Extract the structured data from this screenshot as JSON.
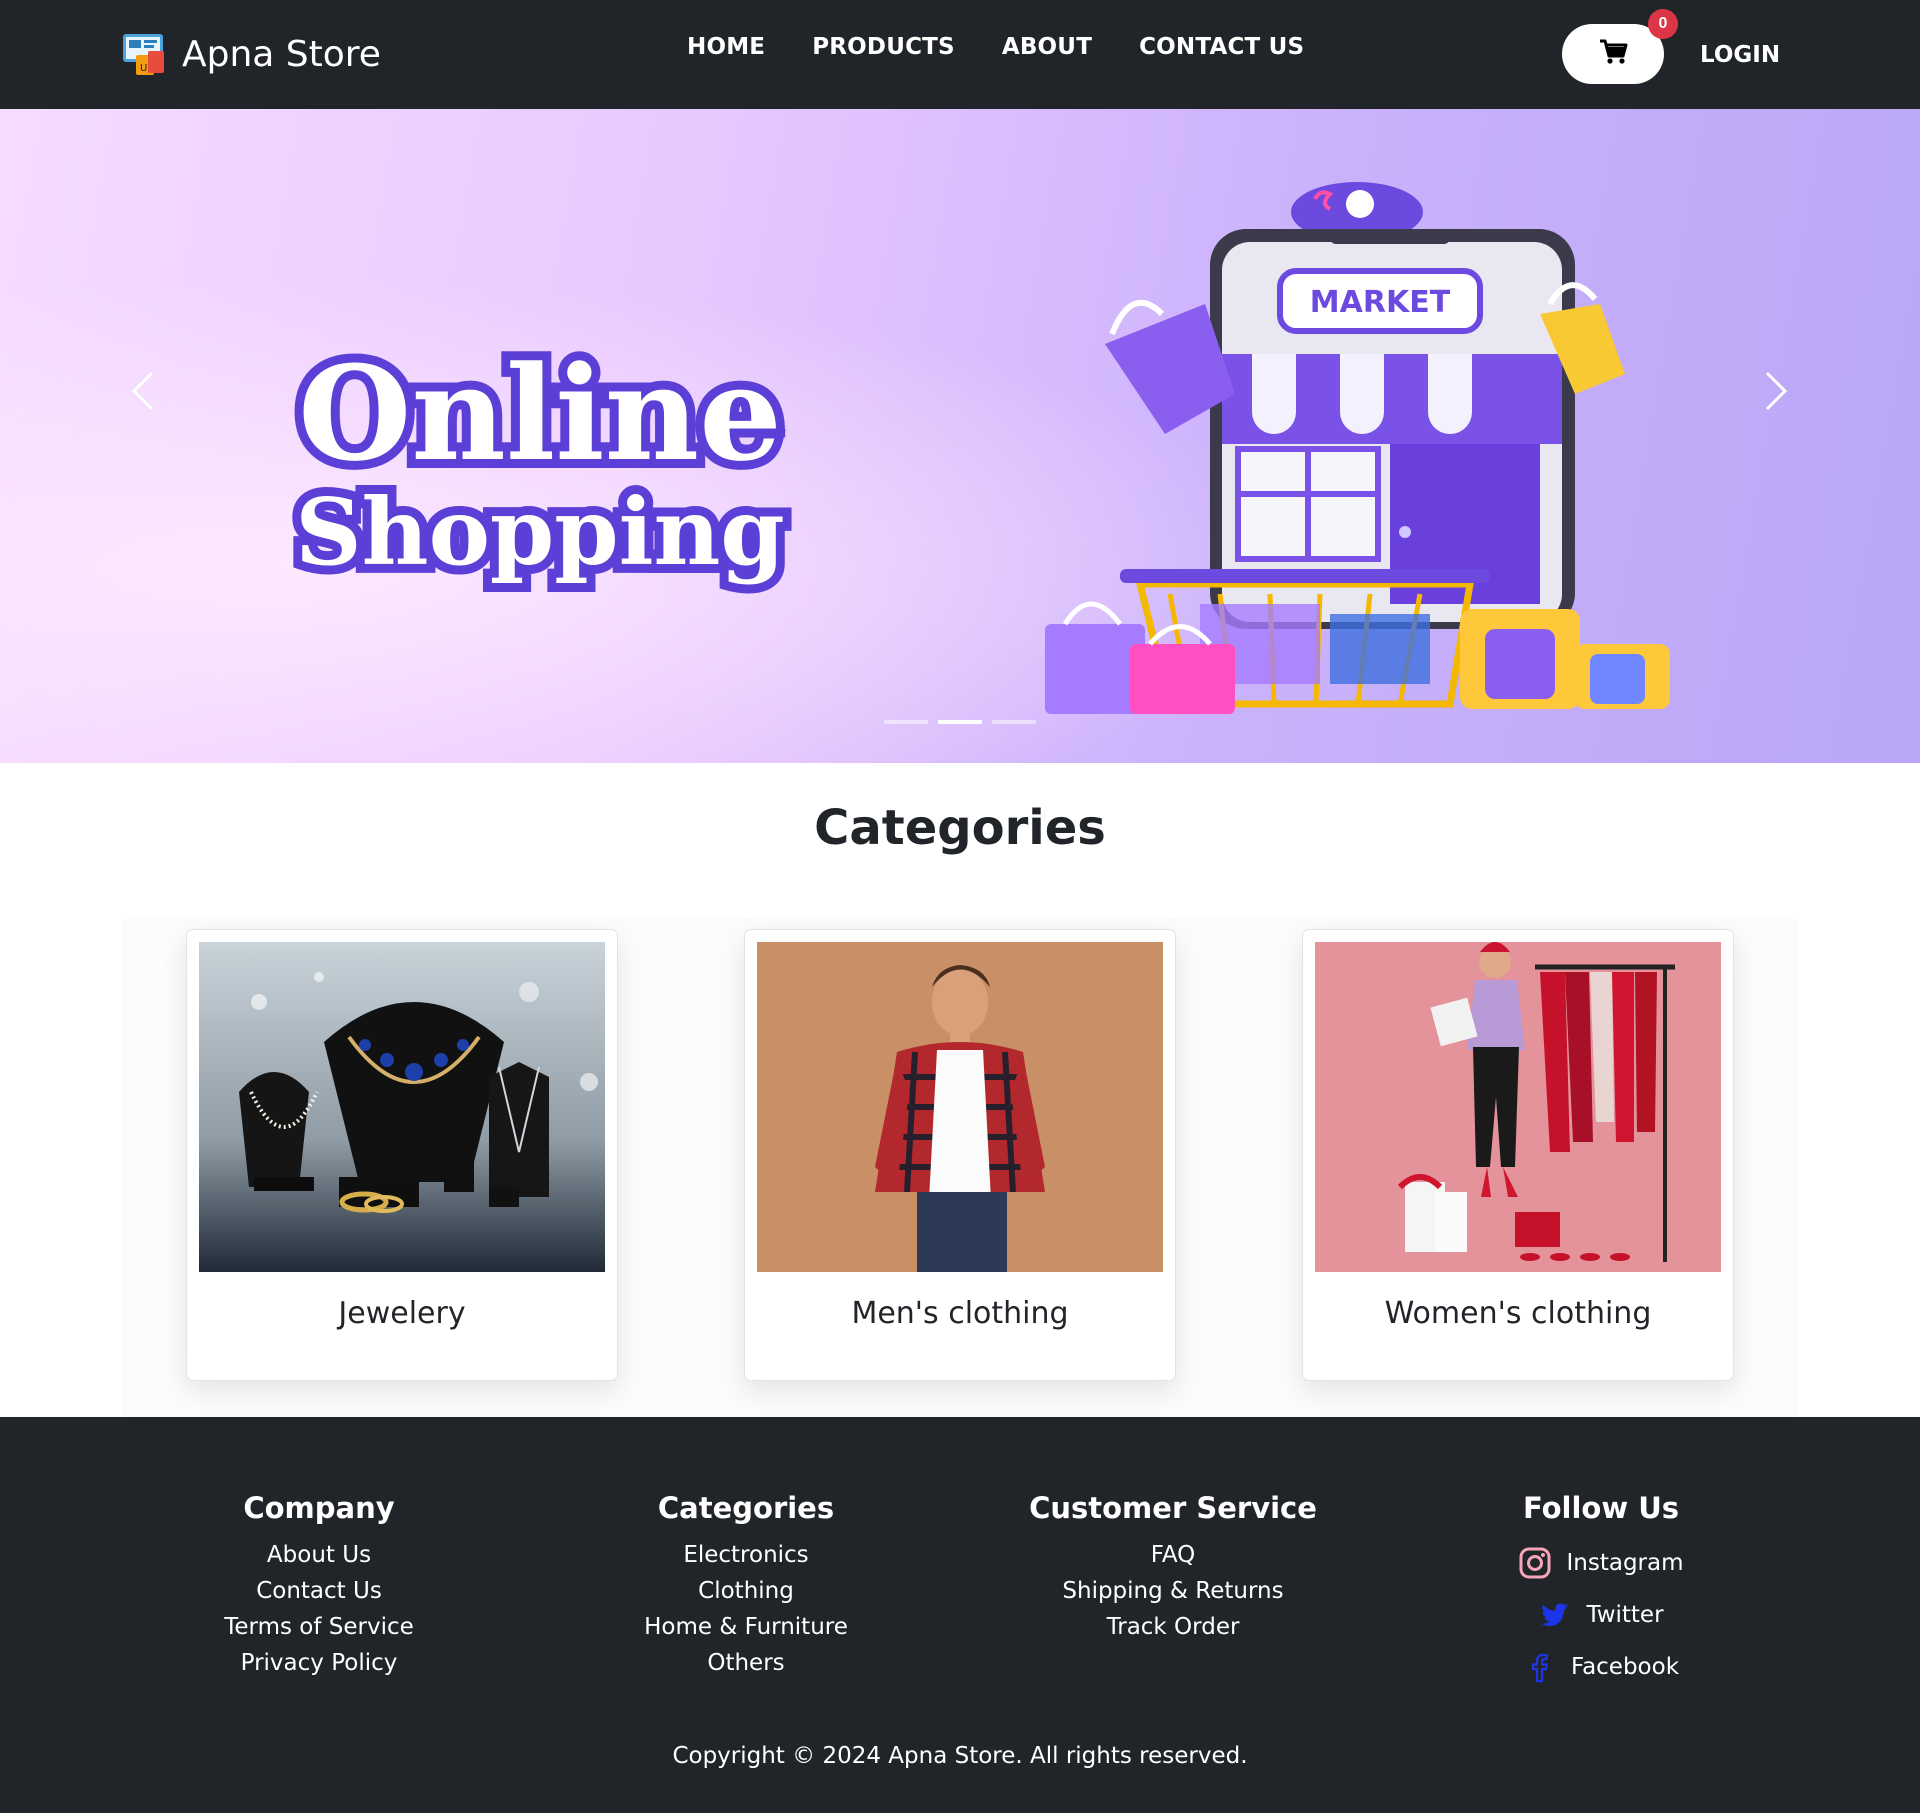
{
  "brand": {
    "name": "Apna Store",
    "logo_icon": "store-logo-icon"
  },
  "nav": {
    "items": [
      "HOME",
      "PRODUCTS",
      "ABOUT",
      "CONTACT US"
    ],
    "cart_count": "0",
    "login": "LOGIN"
  },
  "hero": {
    "title_line1": "Online",
    "title_line2": "Shopping",
    "sign_text": "MARKET",
    "slides": 3,
    "active_slide": 2,
    "accent_color": "#5b3fd6"
  },
  "categories": {
    "heading": "Categories",
    "items": [
      {
        "label": "Jewelery"
      },
      {
        "label": "Men's clothing"
      },
      {
        "label": "Women's clothing"
      }
    ]
  },
  "footer": {
    "company": {
      "title": "Company",
      "links": [
        "About Us",
        "Contact Us",
        "Terms of Service",
        "Privacy Policy"
      ]
    },
    "categories": {
      "title": "Categories",
      "links": [
        "Electronics",
        "Clothing",
        "Home & Furniture",
        "Others"
      ]
    },
    "service": {
      "title": "Customer Service",
      "links": [
        "FAQ",
        "Shipping & Returns",
        "Track Order"
      ]
    },
    "follow": {
      "title": "Follow Us",
      "links": [
        "Instagram",
        "Twitter",
        "Facebook"
      ]
    },
    "copyright": "Copyright © 2024 Apna Store. All rights reserved."
  },
  "colors": {
    "navbar": "#212529",
    "badge": "#dc3545",
    "hero_purple": "#5b3fd6"
  }
}
